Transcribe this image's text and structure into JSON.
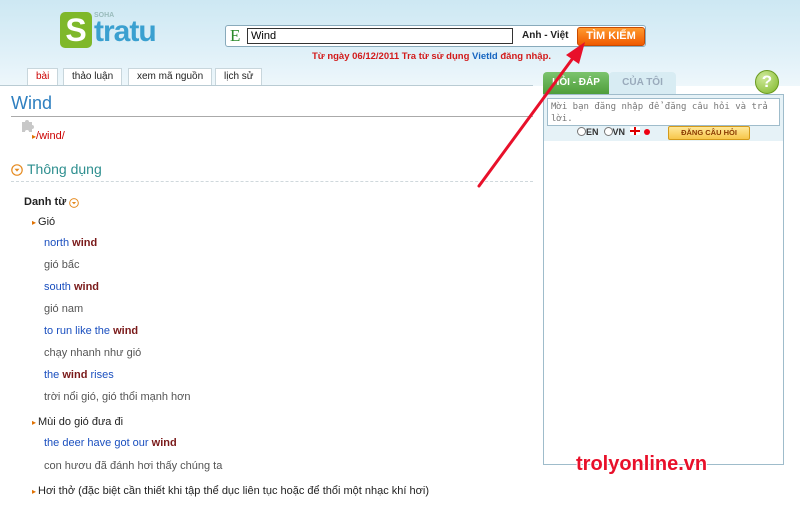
{
  "logo": {
    "brand": "SOHA",
    "s": "S",
    "text": "tratu"
  },
  "search": {
    "lang_letter": "E",
    "value": "Wind",
    "dictionary": "Anh - Việt",
    "button": "TÌM KIẾM",
    "notice_prefix": "Từ ngày 06/12/2011 Tra từ sử dụng ",
    "notice_link": "VietId",
    "notice_suffix": " đăng nhập."
  },
  "tabs": [
    {
      "label": "bài",
      "active": true
    },
    {
      "label": "thảo luận"
    },
    {
      "label": "xem mã nguồn"
    },
    {
      "label": "lịch sử"
    }
  ],
  "entry": {
    "word": "Wind",
    "pronunciation": "/wind/",
    "section": "Thông dụng",
    "pos": "Danh từ",
    "meanings": [
      {
        "text": "Gió"
      },
      {
        "text": "Mùi do gió đưa đi"
      },
      {
        "text": "Hơi thở (đặc biệt cần thiết khi tập thể dục liên tục hoặc để thổi một nhạc khí hơi)"
      }
    ],
    "examples": [
      {
        "en_before": "north ",
        "en_word": "wind",
        "en_after": "",
        "vi": "gió bấc"
      },
      {
        "en_before": "south ",
        "en_word": "wind",
        "en_after": "",
        "vi": "gió nam"
      },
      {
        "en_before": "to run like the ",
        "en_word": "wind",
        "en_after": "",
        "vi": "chạy nhanh như gió"
      },
      {
        "en_before": "the ",
        "en_word": "wind",
        "en_after": " rises",
        "vi": "trời nổi gió, gió thổi mạnh hơn"
      },
      {
        "en_before": "the deer have got our ",
        "en_word": "wind",
        "en_after": "",
        "vi": "con hươu đã đánh hơi thấy chúng ta"
      }
    ]
  },
  "right_panel": {
    "tab_active": "HỎI - ĐÁP",
    "tab_other": "CỦA TÔI",
    "help": "?",
    "placeholder": "Mời bạn đăng nhập để đăng câu hỏi và trả lời.",
    "opt_en": "EN",
    "opt_vn": "VN",
    "ask_button": "ĐĂNG CÂU HỎI"
  },
  "watermark": "trolyonline.vn",
  "colors": {
    "accent_orange": "#f05a00",
    "link_blue": "#2e7fc0",
    "annotation_red": "#e8102a"
  }
}
